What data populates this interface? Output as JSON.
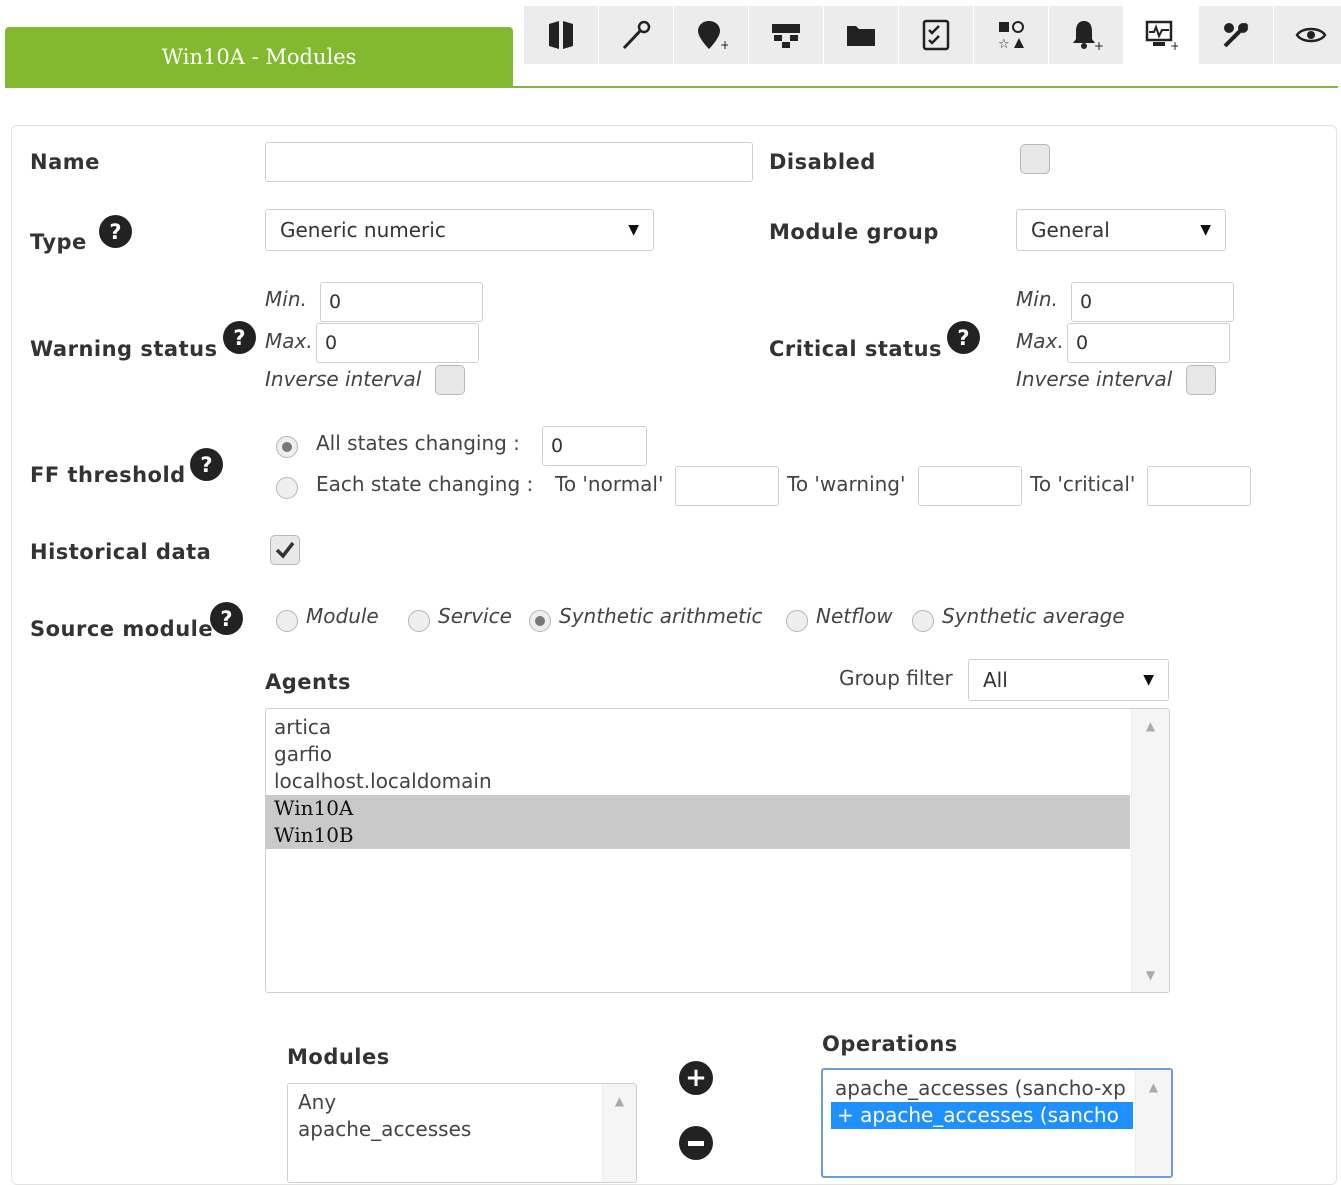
{
  "header": {
    "title": "Win10A - Modules"
  },
  "toolbar": {
    "icons": [
      "agent-view-icon",
      "wand-icon",
      "add-location-icon",
      "network-icon",
      "folder-icon",
      "checklist-icon",
      "shapes-icon",
      "add-alert-icon",
      "add-module-icon",
      "tools-icon",
      "eye-icon"
    ],
    "active_index": 8
  },
  "form": {
    "name": {
      "label": "Name",
      "value": ""
    },
    "disabled": {
      "label": "Disabled",
      "checked": false
    },
    "type": {
      "label": "Type",
      "value": "Generic numeric"
    },
    "module_group": {
      "label": "Module group",
      "value": "General"
    },
    "warning": {
      "label": "Warning status",
      "min_label": "Min.",
      "min": "0",
      "max_label": "Max.",
      "max": "0",
      "inverse_label": "Inverse interval"
    },
    "critical": {
      "label": "Critical status",
      "min_label": "Min.",
      "min": "0",
      "max_label": "Max.",
      "max": "0",
      "inverse_label": "Inverse interval"
    },
    "ff": {
      "label": "FF threshold",
      "all_label": "All states changing :",
      "all_value": "0",
      "each_label": "Each state changing :",
      "to_normal": "To 'normal'",
      "to_warning": "To 'warning'",
      "to_critical": "To 'critical'"
    },
    "historical": {
      "label": "Historical data",
      "checked": true
    },
    "source": {
      "label": "Source module",
      "options": [
        "Module",
        "Service",
        "Synthetic arithmetic",
        "Netflow",
        "Synthetic average"
      ],
      "selected": "Synthetic arithmetic"
    },
    "agents": {
      "label": "Agents",
      "group_filter_label": "Group filter",
      "group_filter_value": "All",
      "items": [
        "artica",
        "garfio",
        "localhost.localdomain",
        "Win10A",
        "Win10B"
      ],
      "selected": [
        "Win10A",
        "Win10B"
      ]
    },
    "modules": {
      "label": "Modules",
      "items": [
        "Any",
        "apache_accesses"
      ]
    },
    "operations": {
      "label": "Operations",
      "items": [
        "apache_accesses (sancho-xp",
        "+ apache_accesses (sancho"
      ]
    }
  }
}
